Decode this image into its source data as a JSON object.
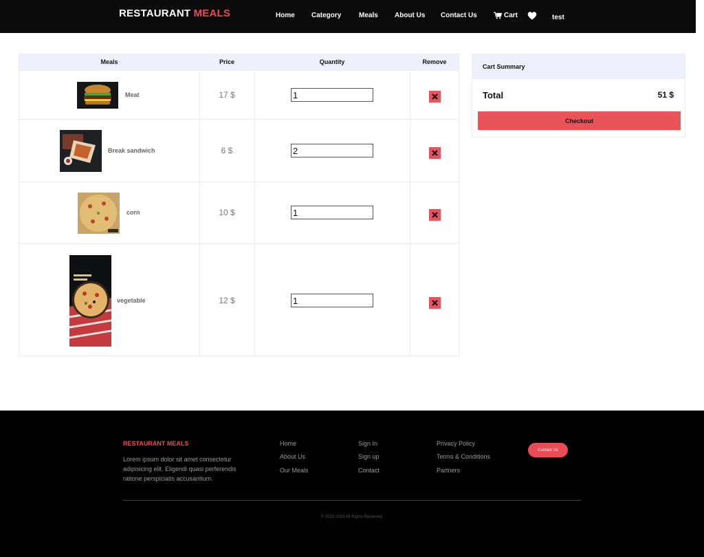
{
  "header": {
    "brand_primary": "RESTAURANT",
    "brand_accent": "MEALS",
    "nav": [
      {
        "label": "Home"
      },
      {
        "label": "Category"
      },
      {
        "label": "Meals"
      },
      {
        "label": "About Us"
      },
      {
        "label": "Contact Us"
      },
      {
        "label": "Cart",
        "icon": "cart-icon"
      }
    ],
    "favorites_icon": "heart-icon",
    "username": "test"
  },
  "cart_table": {
    "columns": [
      "Meals",
      "Price",
      "Quantity",
      "Remove"
    ],
    "rows": [
      {
        "name": "Meat",
        "price": "17 $",
        "quantity": "1",
        "image": "burger-image"
      },
      {
        "name": "Break sandwich",
        "price": "6 $",
        "quantity": "2",
        "image": "sandwich-image"
      },
      {
        "name": "corn",
        "price": "10 $",
        "quantity": "1",
        "image": "pizza-image"
      },
      {
        "name": "vegetable",
        "price": "12 $",
        "quantity": "1",
        "image": "pizza-poster-image"
      }
    ],
    "remove_icon": "close-icon",
    "remove_color": "#e25560"
  },
  "summary": {
    "title": "Cart Summary",
    "total_label": "Total",
    "total_value": "51 $",
    "checkout_label": "Checkout"
  },
  "footer": {
    "brand": "RESTAURANT MEALS",
    "description": "Lorem ipsum dolor sit amet consectetur adipisicing elit. Eligendi quasi perferendis ratione perspiciatis accusantium.",
    "col1": [
      "Home",
      "About Us",
      "Our Meals"
    ],
    "col2": [
      "Sign In",
      "Sign up",
      "Contact"
    ],
    "col3": [
      "Privacy Policy",
      "Terms & Conditions",
      "Partners"
    ],
    "contact_label": "Contact Us",
    "copyright": "© 2022-2023 All Rights Reserved."
  },
  "colors": {
    "accent": "#ea4a54",
    "header_bg": "#0b0b0b",
    "table_header_bg": "#eef1fb"
  }
}
